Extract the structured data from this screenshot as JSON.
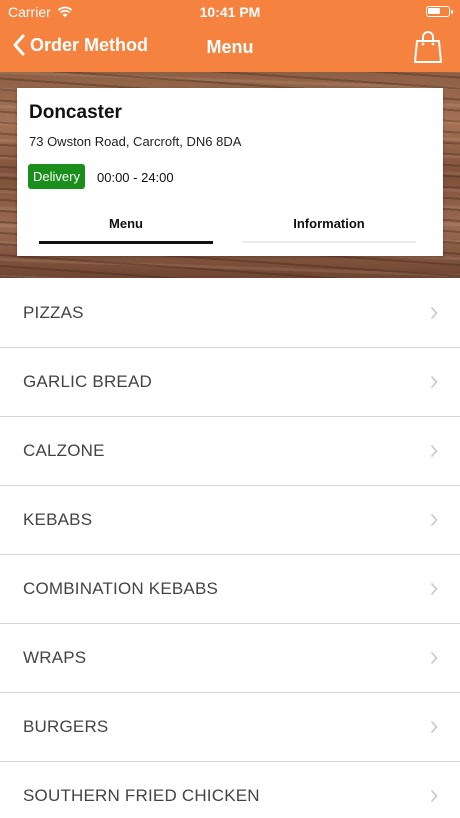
{
  "status": {
    "carrier": "Carrier",
    "time": "10:41 PM"
  },
  "nav": {
    "back_label": "Order Method",
    "title": "Menu"
  },
  "store": {
    "name": "Doncaster",
    "address": "73 Owston Road, Carcroft, DN6 8DA",
    "badge": "Delivery",
    "hours": "00:00 - 24:00"
  },
  "tabs": [
    {
      "label": "Menu",
      "active": true
    },
    {
      "label": "Information",
      "active": false
    }
  ],
  "categories": [
    "PIZZAS",
    "GARLIC BREAD",
    "CALZONE",
    "KEBABS",
    "COMBINATION KEBABS",
    "WRAPS",
    "BURGERS",
    "SOUTHERN FRIED CHICKEN"
  ],
  "colors": {
    "accent": "#f5823e",
    "badge": "#1b8f1b"
  }
}
